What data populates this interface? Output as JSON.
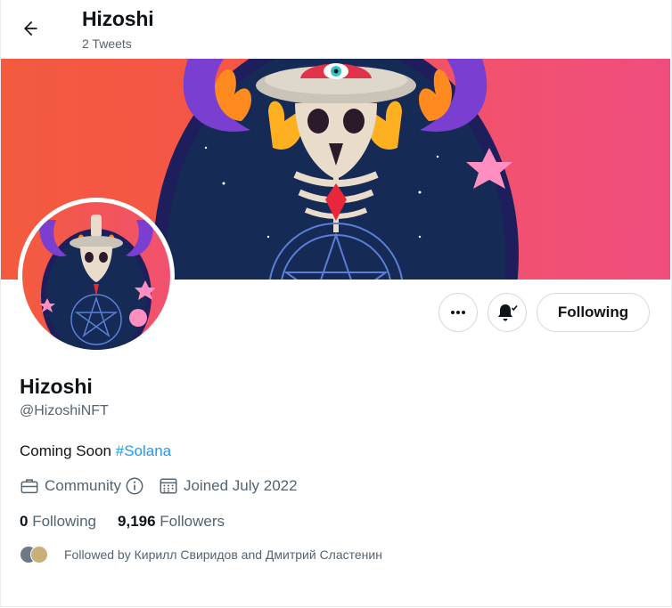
{
  "header": {
    "back_icon": "arrow-left-icon",
    "title": "Hizoshi",
    "subtitle": "2 Tweets"
  },
  "actions": {
    "more_icon": "more-dots-icon",
    "bell_icon": "bell-subscribed-icon",
    "following_label": "Following"
  },
  "profile": {
    "name": "Hizoshi",
    "handle": "@HizoshiNFT",
    "bio_text": "Coming Soon ",
    "bio_hashtag": "#Solana",
    "category": "Community",
    "joined": "Joined July 2022",
    "following_count": "0",
    "following_label": " Following",
    "followers_count": "9,196",
    "followers_label": " Followers",
    "followed_by": "Followed by Кирилл Свиридов and Дмитрий Сластенин"
  },
  "colors": {
    "link": "#1d9bf0",
    "secondary_text": "#536471",
    "banner_left": "#f35a3e",
    "banner_right": "#f04d7e"
  }
}
